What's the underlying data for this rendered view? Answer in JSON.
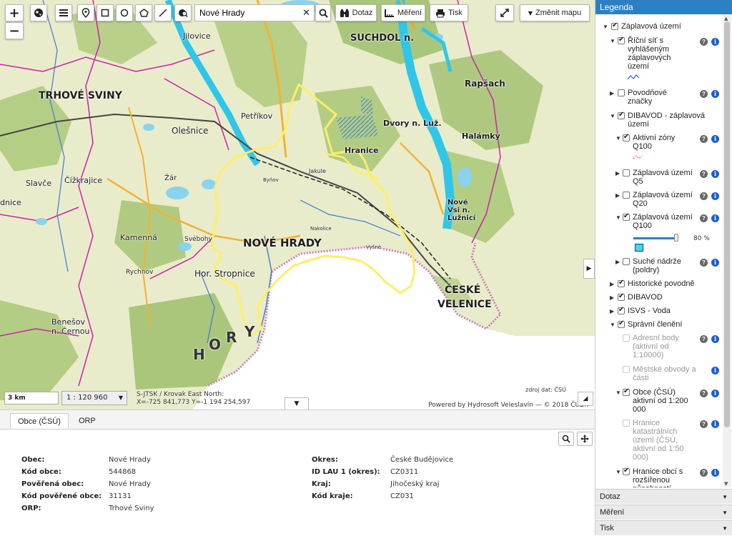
{
  "toolbar": {
    "search_value": "Nové Hrady",
    "query_label": "Dotaz",
    "measure_label": "Měření",
    "print_label": "Tisk",
    "change_map_label": "Změnit mapu"
  },
  "map": {
    "places": [
      {
        "name": "SUCHDOL n."
      },
      {
        "name": "TRHOVÉ SVINY"
      },
      {
        "name": "Petříkov"
      },
      {
        "name": "Olešnice"
      },
      {
        "name": "Dvory n. Luž."
      },
      {
        "name": "Rapšach"
      },
      {
        "name": "Halámky"
      },
      {
        "name": "Hranice"
      },
      {
        "name": "Jakule"
      },
      {
        "name": "Slavče"
      },
      {
        "name": "Čížkrajice"
      },
      {
        "name": "dnice"
      },
      {
        "name": "Kamenná"
      },
      {
        "name": "NOVÉ HRADY"
      },
      {
        "name": "Hor. Stropnice"
      },
      {
        "name": "Nakolice"
      },
      {
        "name": "Nové Vsi n. Lužnicí"
      },
      {
        "name": "ČESKÉ"
      },
      {
        "name": "VELENICE"
      },
      {
        "name": "Benešov n. Černou"
      },
      {
        "name": "Jilovice"
      },
      {
        "name": "Vyšné"
      },
      {
        "name": "Byňov"
      },
      {
        "name": "Žár"
      },
      {
        "name": "Svébohy"
      },
      {
        "name": "Rychnov"
      }
    ],
    "mountain_letters": [
      "H",
      "O",
      "R",
      "Y"
    ],
    "scale_text": "3 km",
    "scale_value": "1 : 120 960",
    "crs_line1": "S-JTSK / Krovak East North:",
    "crs_line2": "X=-725 841,773 Y=-1 194 254,597",
    "source_text": "zdroj dat: ČSÚ",
    "credit_text": "Powered by Hydrosoft Veleslavín — © 2018 ČÚZK"
  },
  "legend": {
    "title": "Legenda",
    "items": [
      {
        "label": "Záplavová území"
      },
      {
        "label": "Říční síť s vyhlášeným záplavových území"
      },
      {
        "label": "Povodňové značky"
      },
      {
        "label": "DIBAVOD - záplavová území"
      },
      {
        "label": "Aktivní zóny Q100"
      },
      {
        "label": "Záplavová území Q5"
      },
      {
        "label": "Záplavová území Q20"
      },
      {
        "label": "Záplavová území Q100"
      },
      {
        "label": "Suché nádrže (poldry)"
      },
      {
        "label": "Historické povodně"
      },
      {
        "label": "DIBAVOD"
      },
      {
        "label": "ISVS - Voda"
      },
      {
        "label": "Správní členění"
      },
      {
        "label": "Adresní body (aktivní od 1:10000)"
      },
      {
        "label": "Městské obvody a části"
      },
      {
        "label": "Obce (ČSÚ) aktivní od 1:200 000"
      },
      {
        "label": "Hranice katastrálních území (ČSÚ, aktivní od 1:50 000)"
      },
      {
        "label": "Hranice obcí s rozšířenou působností"
      }
    ],
    "opacity_value": "80 %",
    "opacity_level": 0.8
  },
  "accordion": {
    "query": "Dotaz",
    "measure": "Měření",
    "print": "Tisk"
  },
  "bottom": {
    "tabs": [
      "Obce (ČSÚ)",
      "ORP"
    ],
    "attributes_left": [
      {
        "label": "Obec:",
        "value": "Nové Hrady"
      },
      {
        "label": "Kód obce:",
        "value": "544868"
      },
      {
        "label": "Pověřená obec:",
        "value": "Nové Hrady"
      },
      {
        "label": "Kód pověřené obce:",
        "value": "31131"
      },
      {
        "label": "ORP:",
        "value": "Trhové Sviny"
      }
    ],
    "attributes_right": [
      {
        "label": "Okres:",
        "value": "České Budějovice"
      },
      {
        "label": "ID LAU 1 (okres):",
        "value": "CZ0311"
      },
      {
        "label": "Kraj:",
        "value": "Jihočeský kraj"
      },
      {
        "label": "Kód kraje:",
        "value": "CZ031"
      }
    ]
  },
  "colors": {
    "header_blue": "#2c80c2",
    "flood_cyan": "#33ccee",
    "boundary_magenta": "#cc22aa",
    "selected_yellow": "#ffee66"
  }
}
